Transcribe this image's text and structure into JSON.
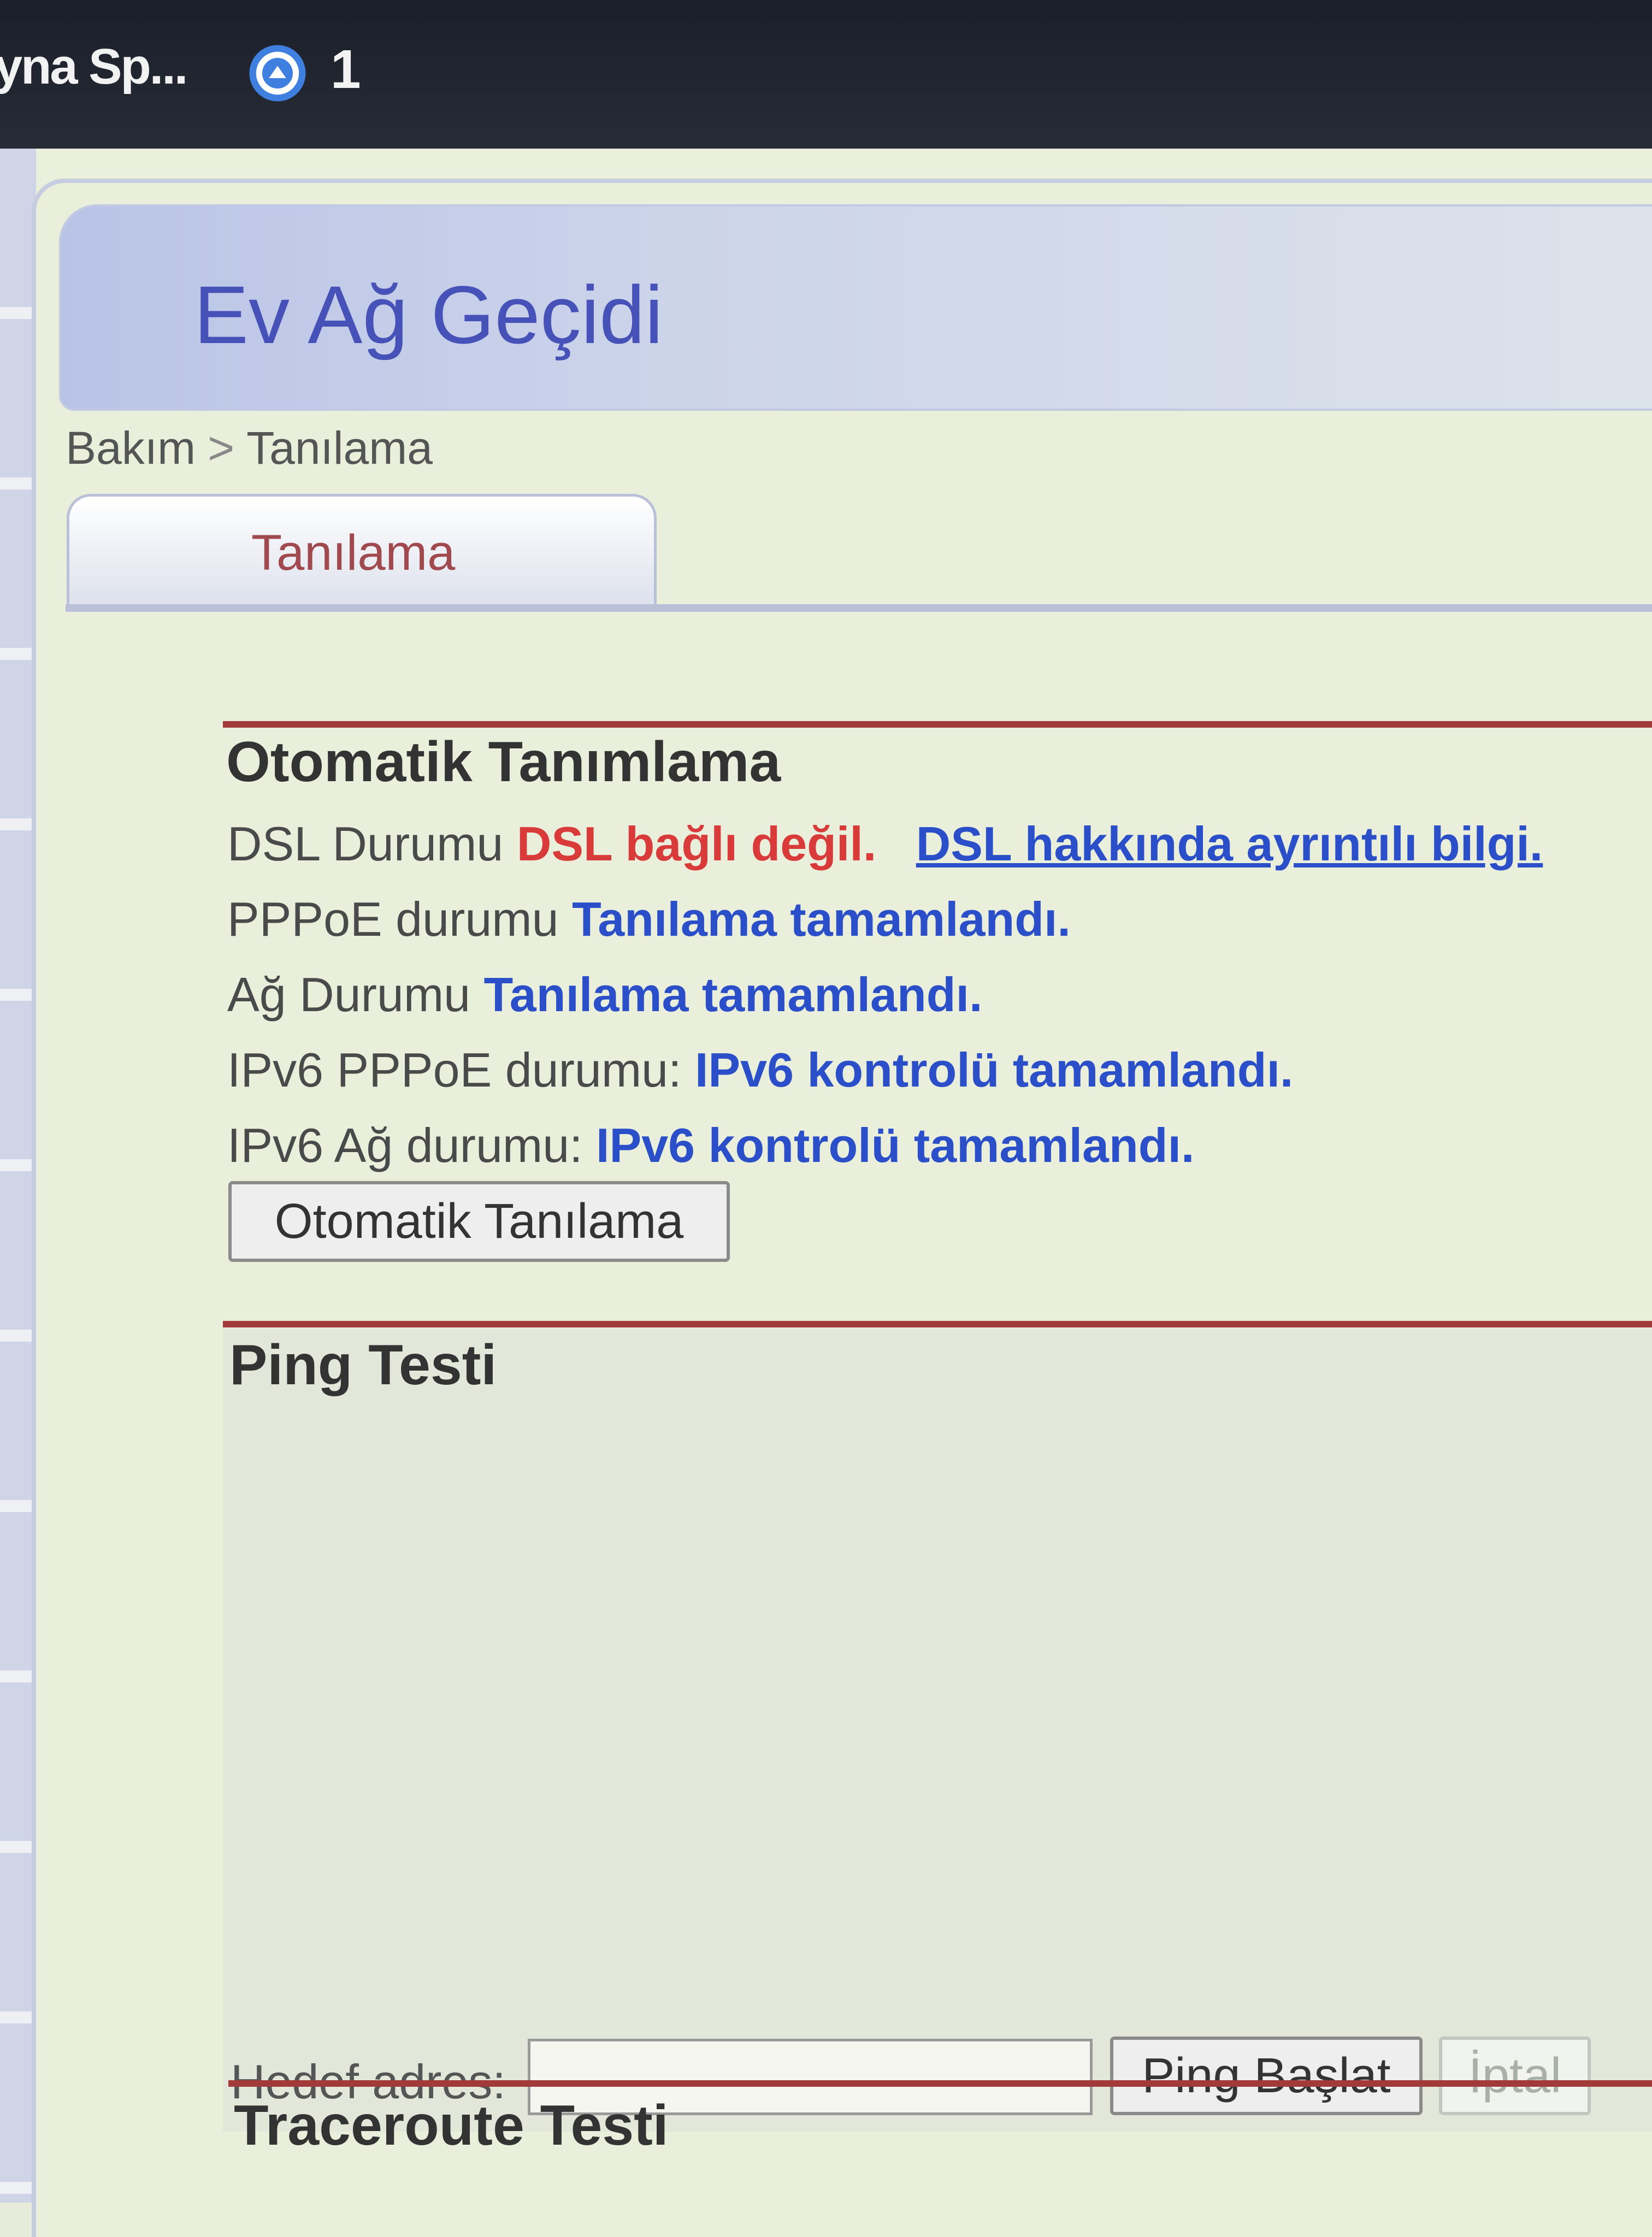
{
  "taskbar": {
    "app_title": "yna Sp...",
    "badge_count": "1",
    "icon": "notification-circle-icon"
  },
  "header": {
    "title": "Ev Ağ Geçidi"
  },
  "breadcrumb": {
    "parent": "Bakım",
    "separator": ">",
    "current": "Tanılama"
  },
  "tabs": [
    {
      "label": "Tanılama"
    }
  ],
  "auto_diagnosis": {
    "title": "Otomatik Tanımlama",
    "rows": [
      {
        "label": "DSL Durumu",
        "value": "DSL bağlı değil.",
        "link": "DSL hakkında ayrıntılı bilgi."
      },
      {
        "label": "PPPoE durumu",
        "value": "Tanılama tamamlandı."
      },
      {
        "label": "Ağ Durumu",
        "value": "Tanılama tamamlandı."
      },
      {
        "label": "IPv6 PPPoE durumu:",
        "value": "IPv6 kontrolü tamamlandı."
      },
      {
        "label": "IPv6 Ağ durumu:",
        "value": "IPv6 kontrolü tamamlandı."
      }
    ],
    "button_label": "Otomatik Tanılama"
  },
  "ping_test": {
    "title": "Ping Testi",
    "target_label": "Hedef adres:",
    "target_value": "",
    "start_label": "Ping Başlat",
    "cancel_label": "İptal"
  },
  "traceroute_test": {
    "title": "Traceroute Testi"
  },
  "colors": {
    "accent_blue": "#2a4fc9",
    "error_red": "#d93b3b",
    "section_rule": "#a33a3a",
    "title_blue": "#4652b8"
  }
}
